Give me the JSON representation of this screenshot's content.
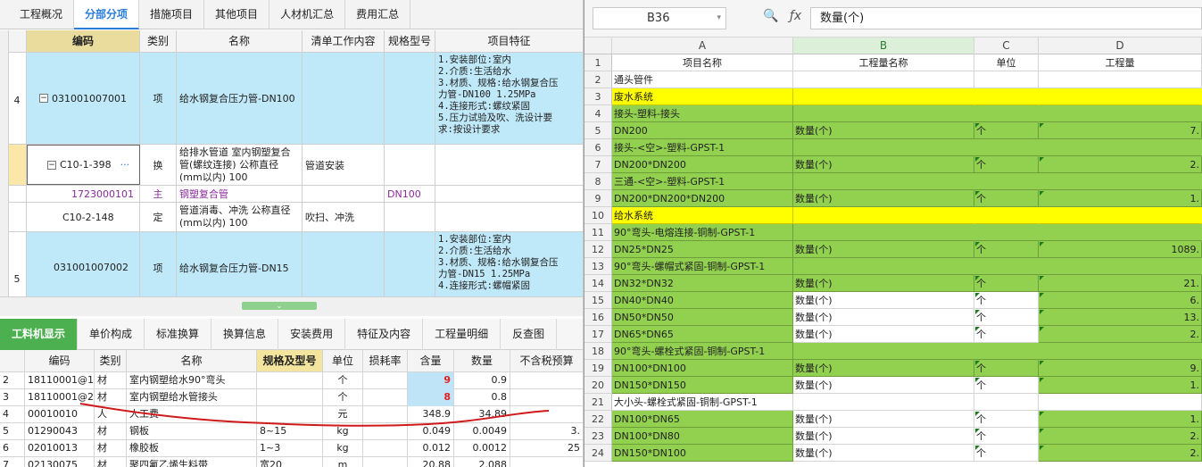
{
  "left": {
    "top_tabs": [
      "工程概况",
      "分部分项",
      "措施项目",
      "其他项目",
      "人材机汇总",
      "费用汇总"
    ],
    "active_top_tab": 1,
    "grid_headers": [
      "编码",
      "类别",
      "名称",
      "清单工作内容",
      "规格型号",
      "项目特征"
    ],
    "rows": [
      {
        "no": "4",
        "code": "031001007001",
        "type": "项",
        "name": "给水钢复合压力管-DN100",
        "work": "",
        "spec": "",
        "feature": [
          "1.安装部位:室内",
          "2.介质:生活给水",
          "3.材质、规格:给水钢复合压",
          "力管-DN100 1.25MPa",
          "4.连接形式:螺纹紧固",
          "5.压力试验及吹、洗设计要",
          "求:按设计要求"
        ]
      },
      {
        "no": "",
        "code": "C10-1-398",
        "more": "···",
        "type": "换",
        "name": "给排水管道 室内钢塑复合管(螺纹连接) 公称直径(mm以内) 100",
        "work": "管道安装",
        "spec": "",
        "feature": []
      },
      {
        "no": "",
        "code": "1723000101",
        "type": "主",
        "name": "钢塑复合管",
        "work": "",
        "spec": "DN100",
        "feature": []
      },
      {
        "no": "",
        "code": "C10-2-148",
        "type": "定",
        "name": "管道消毒、冲洗 公称直径(mm以内) 100",
        "work": "吹扫、冲洗",
        "spec": "",
        "feature": []
      },
      {
        "no": "5",
        "code": "031001007002",
        "type": "项",
        "name": "给水钢复合压力管-DN15",
        "work": "",
        "spec": "",
        "feature": [
          "1.安装部位:室内",
          "2.介质:生活给水",
          "3.材质、规格:给水钢复合压",
          "力管-DN15 1.25MPa",
          "4.连接形式:螺帽紧固"
        ]
      }
    ],
    "sub_tabs": [
      "工料机显示",
      "单价构成",
      "标准换算",
      "换算信息",
      "安装费用",
      "特征及内容",
      "工程量明细",
      "反查图"
    ],
    "active_sub_tab": 0,
    "sub_headers": [
      "编码",
      "类别",
      "名称",
      "规格及型号",
      "单位",
      "损耗率",
      "含量",
      "数量",
      "不含税预算"
    ],
    "sub_rows": [
      {
        "no": "2",
        "code": "18110001@1",
        "type": "材",
        "name": "室内钢塑给水90°弯头",
        "spec": "",
        "unit": "个",
        "loss": "",
        "content": "9",
        "qty": "0.9",
        "price": ""
      },
      {
        "no": "3",
        "code": "18110001@2",
        "type": "材",
        "name": "室内钢塑给水管接头",
        "spec": "",
        "unit": "个",
        "loss": "",
        "content": "8",
        "qty": "0.8",
        "price": ""
      },
      {
        "no": "4",
        "code": "00010010",
        "type": "人",
        "name": "人工费",
        "spec": "",
        "unit": "元",
        "loss": "",
        "content": "348.9",
        "qty": "34.89",
        "price": ""
      },
      {
        "no": "5",
        "code": "01290043",
        "type": "材",
        "name": "钢板",
        "spec": "8~15",
        "unit": "kg",
        "loss": "",
        "content": "0.049",
        "qty": "0.0049",
        "price": "3."
      },
      {
        "no": "6",
        "code": "02010013",
        "type": "材",
        "name": "橡胶板",
        "spec": "1~3",
        "unit": "kg",
        "loss": "",
        "content": "0.012",
        "qty": "0.0012",
        "price": "25"
      },
      {
        "no": "7",
        "code": "02130075",
        "type": "材",
        "name": "聚四氟乙烯生料带",
        "spec": "宽20",
        "unit": "m",
        "loss": "",
        "content": "20.88",
        "qty": "2.088",
        "price": ""
      }
    ]
  },
  "excel": {
    "name_box": "B36",
    "formula": "数量(个)",
    "col_headers": [
      "A",
      "B",
      "C",
      "D"
    ],
    "rows": [
      {
        "n": "1",
        "style": "plain",
        "a": "项目名称",
        "b": "工程量名称",
        "c": "单位",
        "d": "工程量",
        "center": true
      },
      {
        "n": "2",
        "style": "plain",
        "a": "通头管件",
        "b": "",
        "c": "",
        "d": ""
      },
      {
        "n": "3",
        "style": "yellow",
        "a": "废水系统",
        "b": "",
        "c": "",
        "d": ""
      },
      {
        "n": "4",
        "style": "green",
        "a": "接头-塑料-接头",
        "b": "",
        "c": "",
        "d": ""
      },
      {
        "n": "5",
        "style": "green",
        "a": "DN200",
        "b": "数量(个)",
        "c": "个",
        "d": "7."
      },
      {
        "n": "6",
        "style": "green",
        "a": "接头-<空>-塑料-GPST-1",
        "b": "",
        "c": "",
        "d": ""
      },
      {
        "n": "7",
        "style": "green",
        "a": "DN200*DN200",
        "b": "数量(个)",
        "c": "个",
        "d": "2."
      },
      {
        "n": "8",
        "style": "green",
        "a": "三通-<空>-塑料-GPST-1",
        "b": "",
        "c": "",
        "d": ""
      },
      {
        "n": "9",
        "style": "green",
        "a": "DN200*DN200*DN200",
        "b": "数量(个)",
        "c": "个",
        "d": "1."
      },
      {
        "n": "10",
        "style": "yellow",
        "a": "给水系统",
        "b": "",
        "c": "",
        "d": ""
      },
      {
        "n": "11",
        "style": "green",
        "a": "90°弯头-电熔连接-铜制-GPST-1",
        "b": "",
        "c": "",
        "d": ""
      },
      {
        "n": "12",
        "style": "green",
        "a": "DN25*DN25",
        "b": "数量(个)",
        "c": "个",
        "d": "1089."
      },
      {
        "n": "13",
        "style": "green",
        "a": "90°弯头-螺帽式紧固-铜制-GPST-1",
        "b": "",
        "c": "",
        "d": ""
      },
      {
        "n": "14",
        "style": "green",
        "a": "DN32*DN32",
        "b": "数量(个)",
        "c": "个",
        "d": "21."
      },
      {
        "n": "15",
        "style": "mixed",
        "a": "DN40*DN40",
        "b": "数量(个)",
        "c": "个",
        "d": "6."
      },
      {
        "n": "16",
        "style": "mixed",
        "a": "DN50*DN50",
        "b": "数量(个)",
        "c": "个",
        "d": "13."
      },
      {
        "n": "17",
        "style": "mixed",
        "a": "DN65*DN65",
        "b": "数量(个)",
        "c": "个",
        "d": "2."
      },
      {
        "n": "18",
        "style": "green",
        "a": "90°弯头-螺栓式紧固-铜制-GPST-1",
        "b": "",
        "c": "",
        "d": ""
      },
      {
        "n": "19",
        "style": "green",
        "a": "DN100*DN100",
        "b": "数量(个)",
        "c": "个",
        "d": "9."
      },
      {
        "n": "20",
        "style": "mixed",
        "a": "DN150*DN150",
        "b": "数量(个)",
        "c": "个",
        "d": "1."
      },
      {
        "n": "21",
        "style": "plain",
        "a": "大小头-螺栓式紧固-铜制-GPST-1",
        "b": "",
        "c": "",
        "d": ""
      },
      {
        "n": "22",
        "style": "mixed",
        "a": "DN100*DN65",
        "b": "数量(个)",
        "c": "个",
        "d": "1."
      },
      {
        "n": "23",
        "style": "mixed",
        "a": "DN100*DN80",
        "b": "数量(个)",
        "c": "个",
        "d": "2."
      },
      {
        "n": "24",
        "style": "mixed",
        "a": "DN150*DN100",
        "b": "数量(个)",
        "c": "个",
        "d": "2."
      }
    ]
  },
  "colors": {
    "accent": "#2a7ed8",
    "tab_green": "#4caf50",
    "excel_green": "#92d050",
    "excel_yellow": "#ffff00",
    "row_blue": "#bfe8f8",
    "ink_red": "#e02020"
  }
}
